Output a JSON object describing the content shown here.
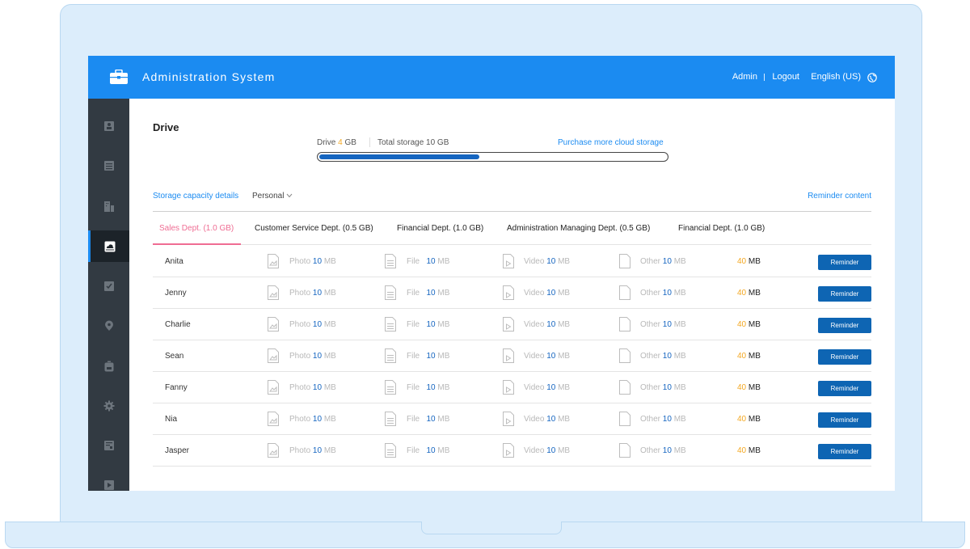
{
  "header": {
    "title": "Administration System",
    "admin": "Admin",
    "logout": "Logout",
    "language": "English (US)"
  },
  "sidebar": {
    "icons": [
      "user-badge-icon",
      "document-icon",
      "buildings-icon",
      "cloud-drive-icon",
      "checklist-icon",
      "location-pin-icon",
      "timer-icon",
      "gear-icon",
      "report-icon",
      "play-icon"
    ],
    "active_index": 3
  },
  "drive": {
    "title": "Drive",
    "used_label": "Drive",
    "used_value": "4",
    "used_unit": "GB",
    "total": "Total storage 10 GB",
    "purchase": "Purchase more cloud storage",
    "used_fraction": 0.46
  },
  "filters": {
    "capacity_link": "Storage capacity details",
    "personal": "Personal",
    "reminder_content": "Reminder content"
  },
  "tabs": [
    "Sales Dept. (1.0 GB)",
    "Customer Service Dept. (0.5 GB)",
    "Financial Dept. (1.0 GB)",
    "Administration Managing Dept. (0.5 GB)",
    "Financial Dept. (1.0 GB)"
  ],
  "file_types": {
    "photo": "Photo",
    "file": "File",
    "video": "Video",
    "other": "Other"
  },
  "unit": "MB",
  "reminder_label": "Reminder",
  "rows": [
    {
      "name": "Anita",
      "photo": "10",
      "file": "10",
      "video": "10",
      "other": "10",
      "total": "40"
    },
    {
      "name": "Jenny",
      "photo": "10",
      "file": "10",
      "video": "10",
      "other": "10",
      "total": "40"
    },
    {
      "name": "Charlie",
      "photo": "10",
      "file": "10",
      "video": "10",
      "other": "10",
      "total": "40"
    },
    {
      "name": "Sean",
      "photo": "10",
      "file": "10",
      "video": "10",
      "other": "10",
      "total": "40"
    },
    {
      "name": "Fanny",
      "photo": "10",
      "file": "10",
      "video": "10",
      "other": "10",
      "total": "40"
    },
    {
      "name": "Nia",
      "photo": "10",
      "file": "10",
      "video": "10",
      "other": "10",
      "total": "40"
    },
    {
      "name": "Jasper",
      "photo": "10",
      "file": "10",
      "video": "10",
      "other": "10",
      "total": "40"
    }
  ]
}
